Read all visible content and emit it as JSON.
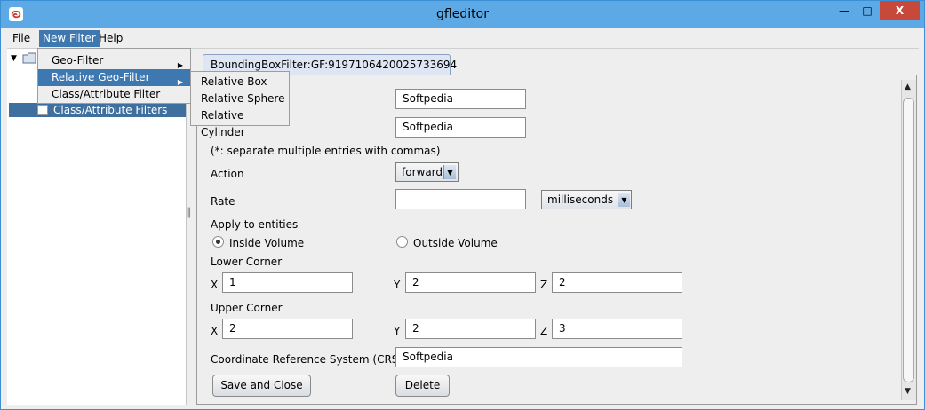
{
  "window": {
    "title": "gfleditor",
    "minimize": "—",
    "maximize": "□",
    "close": "X",
    "colors": {
      "titlebar": "#5da9e6",
      "selection": "#3d78b0",
      "close": "#c7493a"
    }
  },
  "menubar": {
    "items": [
      "File",
      "New Filter",
      "Help"
    ]
  },
  "new_filter_menu": {
    "items": [
      "Geo-Filter",
      "Relative Geo-Filter",
      "Class/Attribute Filter"
    ],
    "active": "Relative Geo-Filter"
  },
  "relative_geo_filter_submenu": {
    "items": [
      "Relative Box",
      "Relative Sphere",
      "Relative Cylinder"
    ]
  },
  "tree": {
    "selected_label": "Class/Attribute Filters"
  },
  "tab": {
    "label": "BoundingBoxFilter:GF:9197106420025733694"
  },
  "form": {
    "field_1": "Softpedia",
    "field_2": "Softpedia",
    "note": "(*: separate multiple entries with commas)",
    "action_label": "Action",
    "action_value": "forward",
    "rate_label": "Rate",
    "rate_value": "",
    "rate_unit": "milliseconds",
    "apply_label": "Apply to entities",
    "inside_label": "Inside Volume",
    "outside_label": "Outside Volume",
    "inside_selected": true,
    "lower_corner_label": "Lower Corner",
    "upper_corner_label": "Upper Corner",
    "x_label": "X",
    "y_label": "Y",
    "z_label": "Z",
    "lower_x": "1",
    "lower_y": "2",
    "lower_z": "2",
    "upper_x": "2",
    "upper_y": "2",
    "upper_z": "3",
    "crs_label": "Coordinate Reference System (CRS)",
    "crs_value": "Softpedia",
    "save_label": "Save and Close",
    "delete_label": "Delete"
  }
}
